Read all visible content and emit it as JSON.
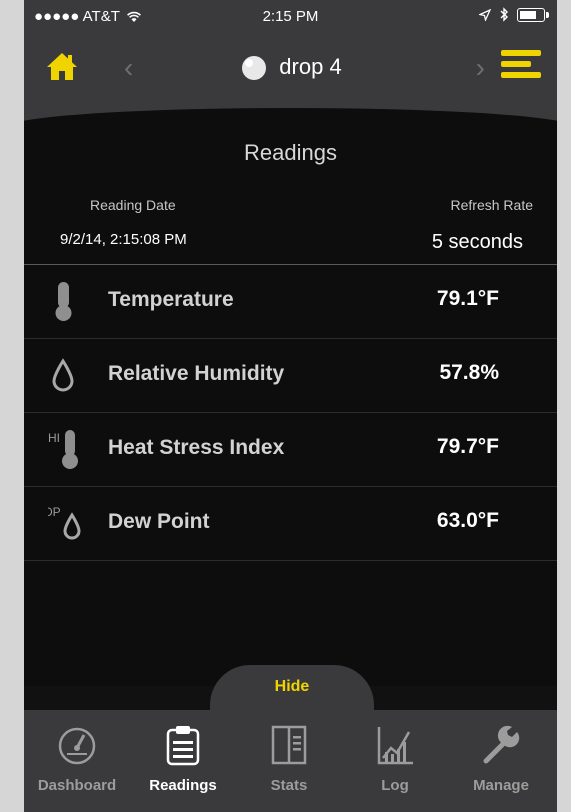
{
  "status_bar": {
    "carrier": "●●●●● AT&T",
    "time": "2:15 PM"
  },
  "nav": {
    "device_name": "drop 4",
    "prev_glyph": "‹",
    "next_glyph": "›",
    "accent_color": "#f0d400"
  },
  "readings": {
    "title": "Readings",
    "reading_date_label": "Reading Date",
    "reading_date_value": "9/2/14, 2:15:08 PM",
    "refresh_rate_label": "Refresh Rate",
    "refresh_rate_value": "5 seconds",
    "rows": [
      {
        "icon": "thermometer-icon",
        "label": "Temperature",
        "value": "79.1°F"
      },
      {
        "icon": "droplet-icon",
        "label": "Relative Humidity",
        "value": "57.8%"
      },
      {
        "icon": "heat-index-icon",
        "icon_text": "HI",
        "label": "Heat Stress Index",
        "value": "79.7°F"
      },
      {
        "icon": "dew-point-icon",
        "icon_text": "DP",
        "label": "Dew Point",
        "value": "63.0°F"
      }
    ]
  },
  "hide_label": "Hide",
  "tabs": [
    {
      "label": "Dashboard",
      "icon": "gauge-icon"
    },
    {
      "label": "Readings",
      "icon": "clipboard-icon",
      "active": true
    },
    {
      "label": "Stats",
      "icon": "stats-icon"
    },
    {
      "label": "Log",
      "icon": "graph-icon"
    },
    {
      "label": "Manage",
      "icon": "wrench-icon"
    }
  ]
}
